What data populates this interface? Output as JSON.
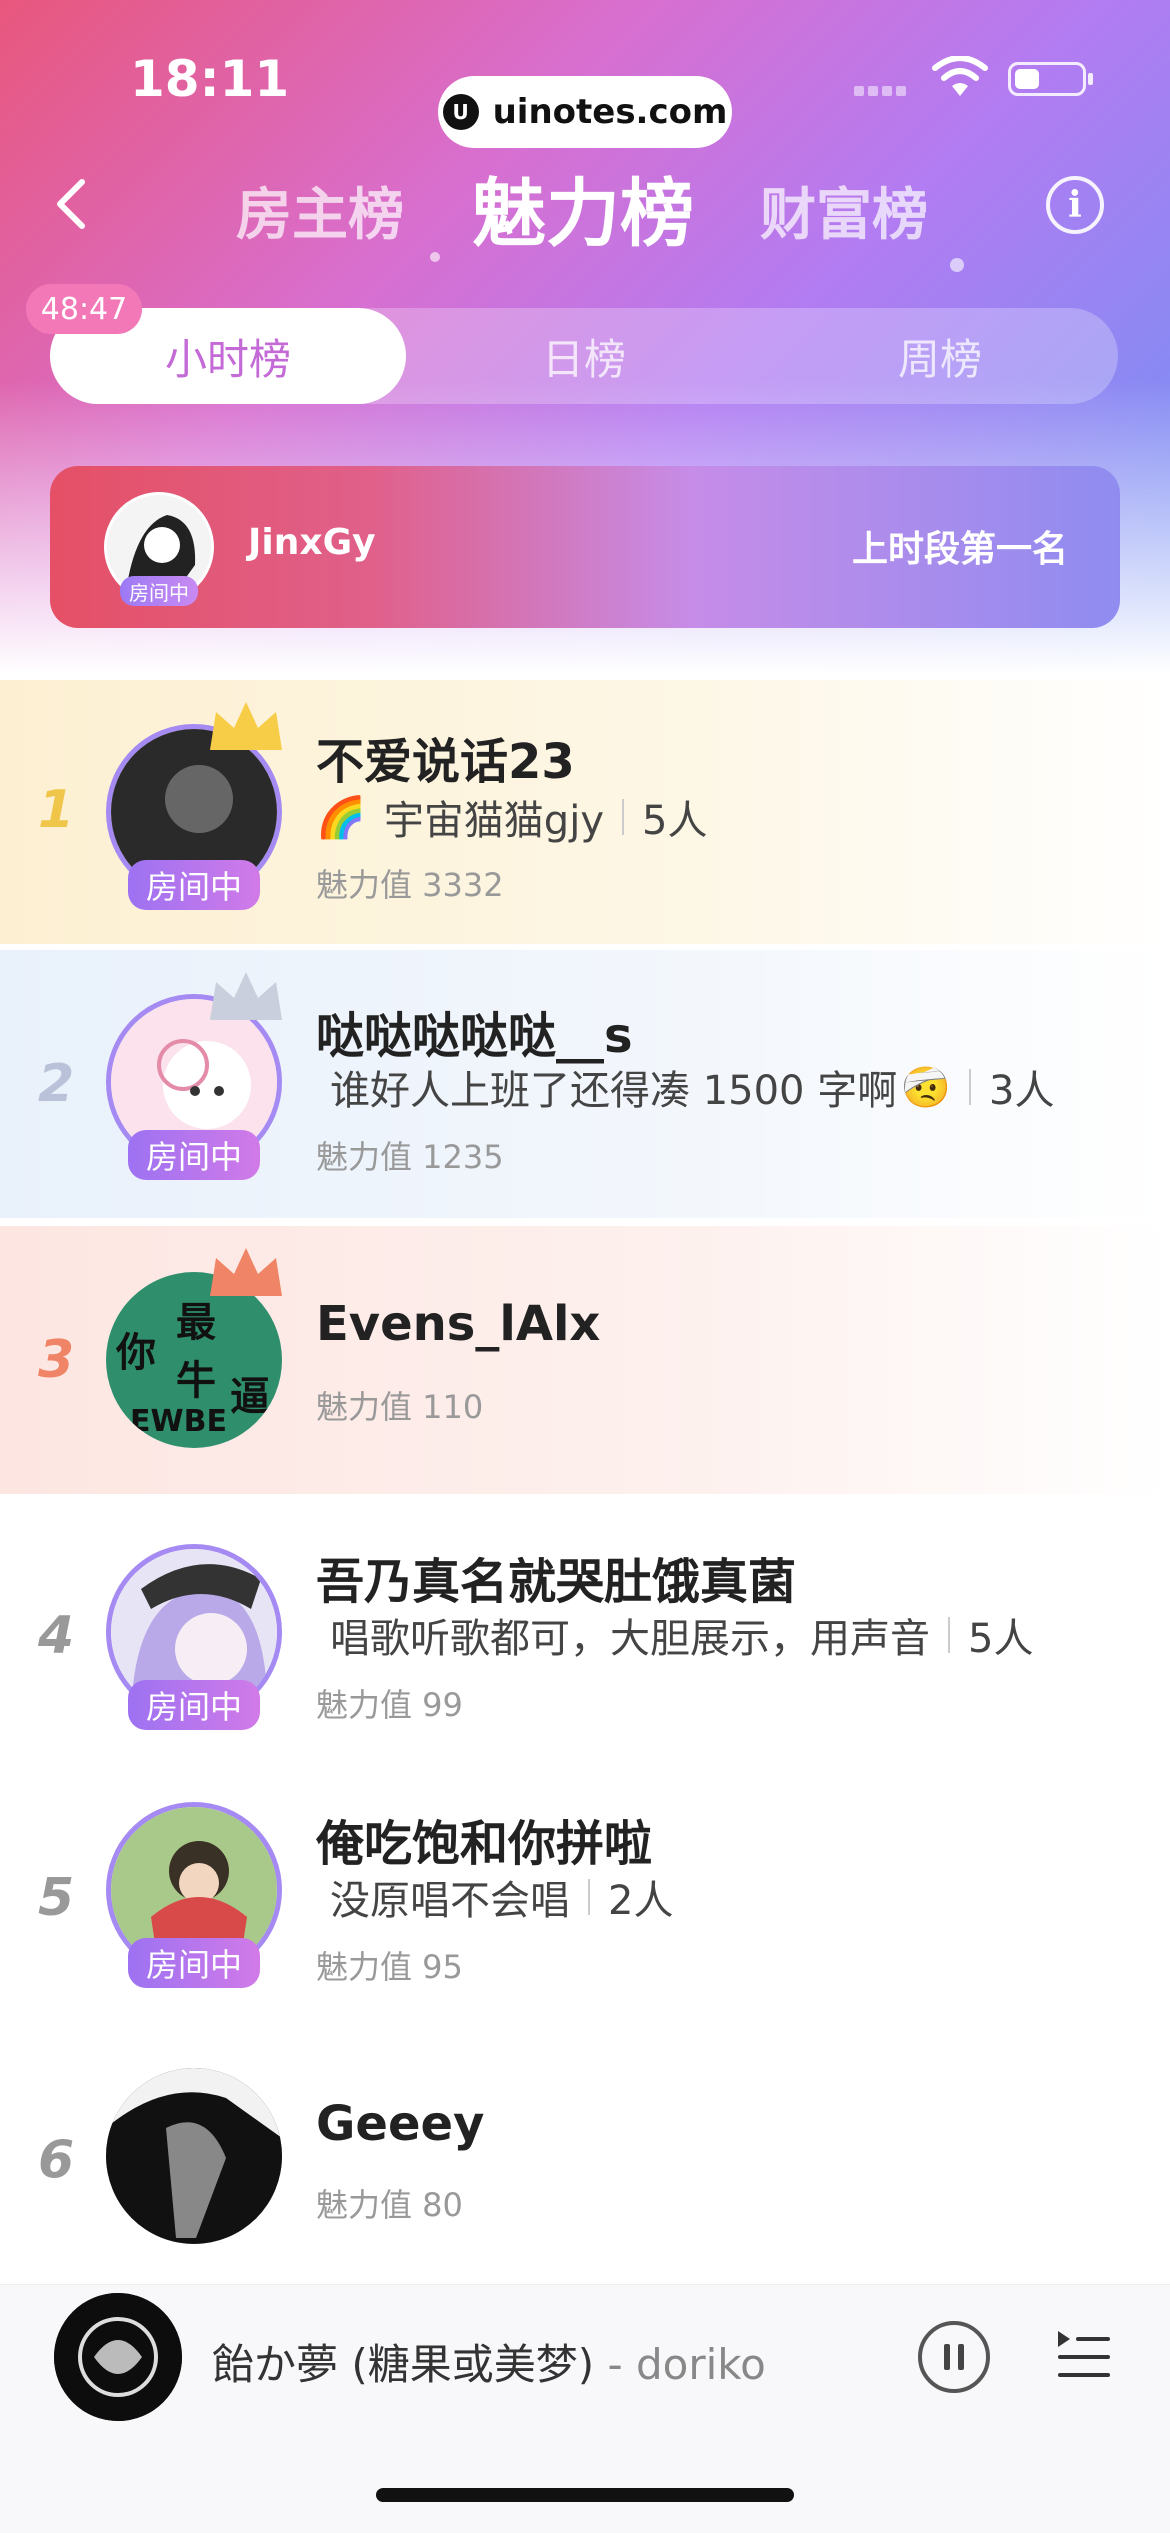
{
  "status_bar": {
    "time": "18:11",
    "url_pill": "uinotes.com"
  },
  "nav": {
    "tabs": [
      "房主榜",
      "魅力榜",
      "财富榜"
    ],
    "active_tab": "魅力榜",
    "info_icon": "i"
  },
  "segments": {
    "options": [
      "小时榜",
      "日榜",
      "周榜"
    ],
    "active": "小时榜",
    "countdown": "48:47"
  },
  "banner": {
    "name": "JinxGy",
    "rank_label": "上时段第一名",
    "tag": "房间中"
  },
  "ranking": [
    {
      "rank": "1",
      "name": "不爱说话23",
      "emoji": "🌈",
      "room": "宇宙猫猫gjy",
      "count": "5人",
      "score": "魅力值 3332",
      "tag": "房间中"
    },
    {
      "rank": "2",
      "name": "哒哒哒哒哒__s",
      "room": "谁好人上班了还得凑 1500 字啊",
      "emoji": "🤕",
      "count": "3人",
      "score": "魅力值 1235",
      "tag": "房间中"
    },
    {
      "rank": "3",
      "name": "Evens_lAlx",
      "score": "魅力值 110",
      "avatar_text": [
        "你",
        "最",
        "牛",
        "逼",
        "EWBE"
      ]
    },
    {
      "rank": "4",
      "name": "吾乃真名就哭肚饿真菌",
      "room": "唱歌听歌都可，大胆展示，用声音",
      "count": "5人",
      "score": "魅力值 99",
      "tag": "房间中"
    },
    {
      "rank": "5",
      "name": "俺吃饱和你拼啦",
      "room": "没原唱不会唱",
      "count": "2人",
      "score": "魅力值 95",
      "tag": "房间中"
    },
    {
      "rank": "6",
      "name": "Geeey",
      "score": "魅力值 80"
    }
  ],
  "player": {
    "song": "飴か夢 (糖果或美梦)",
    "artist": " - doriko"
  },
  "colors": {
    "rank1": "#f0c64a",
    "rank2": "#b9c2d8",
    "rank3": "#f08466",
    "accent": "#c36ad6"
  }
}
